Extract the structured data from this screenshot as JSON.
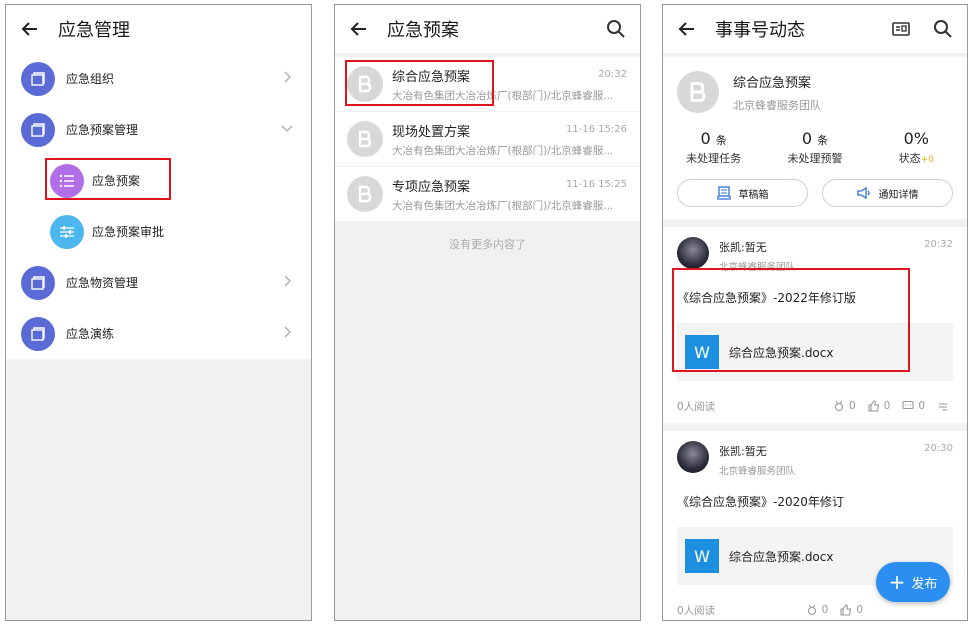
{
  "panel1": {
    "title": "应急管理",
    "menu": [
      {
        "label": "应急组织"
      },
      {
        "label": "应急预案管理"
      },
      {
        "label": "应急物资管理"
      },
      {
        "label": "应急演练"
      }
    ],
    "submenu": [
      {
        "label": "应急预案",
        "color": "#b06fe6"
      },
      {
        "label": "应急预案审批",
        "color": "#4cb6ef"
      }
    ]
  },
  "panel2": {
    "title": "应急预案",
    "items": [
      {
        "title": "综合应急预案",
        "subtitle": "大冶有色集团大冶冶炼厂(根部门)/北京蜂睿服...",
        "time": "20:32"
      },
      {
        "title": "现场处置方案",
        "subtitle": "大冶有色集团大冶冶炼厂(根部门)/北京蜂睿服...",
        "time": "11-16 15:26"
      },
      {
        "title": "专项应急预案",
        "subtitle": "大冶有色集团大冶冶炼厂(根部门)/北京蜂睿服...",
        "time": "11-16 15:25"
      }
    ],
    "no_more": "没有更多内容了"
  },
  "panel3": {
    "title": "事事号动态",
    "account": {
      "name": "综合应急预案",
      "team": "北京蜂睿服务团队"
    },
    "stats": [
      {
        "num": "0",
        "unit": "条",
        "caption": "未处理任务",
        "extra": ""
      },
      {
        "num": "0",
        "unit": "条",
        "caption": "未处理预警",
        "extra": ""
      },
      {
        "num": "0%",
        "unit": "",
        "caption": "状态",
        "extra": "+0"
      }
    ],
    "drafts_label": "草稿箱",
    "notice_label": "通知详情",
    "posts": [
      {
        "author": "张凯:暂无",
        "org": "北京蜂睿服务团队",
        "time": "20:32",
        "title": "《综合应急预案》-2022年修订版",
        "file_letter": "W",
        "file": "综合应急预案.docx",
        "reads": "0人阅读",
        "c1": "0",
        "c2": "0",
        "c3": "0"
      },
      {
        "author": "张凯:暂无",
        "org": "北京蜂睿服务团队",
        "time": "20:30",
        "title": "《综合应急预案》-2020年修订",
        "file_letter": "W",
        "file": "综合应急预案.docx",
        "reads": "0人阅读",
        "c1": "0",
        "c2": "0"
      }
    ],
    "fab_label": "发布"
  },
  "colors": {
    "accent": "#2a8ff0",
    "highlight_box": "#e0141e",
    "menu_icon": "#5b6bd6"
  }
}
